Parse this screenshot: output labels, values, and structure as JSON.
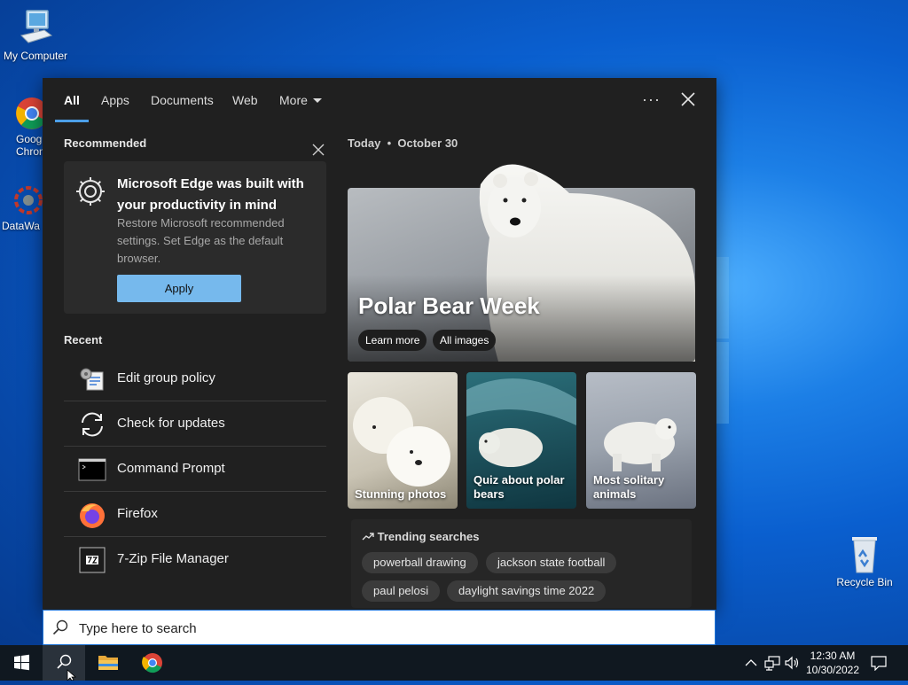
{
  "desktop": {
    "icons": [
      {
        "label": "My Computer"
      },
      {
        "label": "Goog\nChron"
      },
      {
        "label": "DataWa"
      },
      {
        "label": "Recycle Bin"
      }
    ]
  },
  "search_panel": {
    "tabs": [
      {
        "label": "All",
        "active": true
      },
      {
        "label": "Apps"
      },
      {
        "label": "Documents"
      },
      {
        "label": "Web"
      },
      {
        "label": "More"
      }
    ],
    "options_label": "···",
    "recommended": {
      "section_title": "Recommended",
      "card_title": "Microsoft Edge was built with your productivity in mind",
      "card_description": "Restore Microsoft recommended settings. Set Edge as the default browser.",
      "apply_label": "Apply"
    },
    "recent": {
      "section_title": "Recent",
      "items": [
        {
          "label": "Edit group policy",
          "icon": "group-policy-icon"
        },
        {
          "label": "Check for updates",
          "icon": "sync-icon"
        },
        {
          "label": "Command Prompt",
          "icon": "command-prompt-icon"
        },
        {
          "label": "Firefox",
          "icon": "firefox-icon"
        },
        {
          "label": "7-Zip File Manager",
          "icon": "7zip-icon"
        }
      ]
    },
    "today": {
      "day_label": "Today",
      "separator": "•",
      "date_label": "October 30",
      "hero_title": "Polar Bear Week",
      "hero_buttons": [
        "Learn more",
        "All images"
      ],
      "thumbnails": [
        {
          "caption": "Stunning photos"
        },
        {
          "caption": "Quiz about polar bears"
        },
        {
          "caption": "Most solitary animals"
        }
      ],
      "trending_title": "Trending searches",
      "trending": [
        "powerball drawing",
        "jackson state football",
        "paul pelosi",
        "daylight savings time 2022"
      ]
    }
  },
  "search_box": {
    "placeholder": "Type here to search",
    "value": ""
  },
  "taskbar": {
    "clock_time": "12:30 AM",
    "clock_date": "10/30/2022"
  },
  "colors": {
    "accent": "#4c9fe8",
    "apply_button": "#76b9ed",
    "panel_bg": "#202020"
  }
}
